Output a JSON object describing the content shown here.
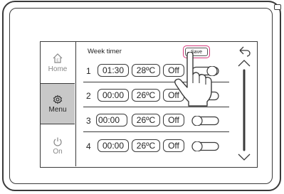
{
  "nav": {
    "items": [
      {
        "label": "Home",
        "icon": "home-icon",
        "active": false
      },
      {
        "label": "Menu",
        "icon": "gear-icon",
        "active": true
      },
      {
        "label": "On",
        "icon": "power-icon",
        "active": false
      }
    ]
  },
  "screen": {
    "title": "Week timer",
    "save_label": "Save"
  },
  "rows": [
    {
      "num": "1",
      "time": "01:30",
      "temp": "28ºC",
      "mode": "Off"
    },
    {
      "num": "2",
      "time": "00:00",
      "temp": "26ºC",
      "mode": "Off"
    },
    {
      "num": "3",
      "time": "00:00",
      "temp": "26ºC",
      "mode": "Off"
    },
    {
      "num": "4",
      "time": "00:00",
      "temp": "26ºC",
      "mode": "Off"
    }
  ],
  "colors": {
    "highlight": "#d4377a",
    "active_nav": "#c8c8c8",
    "outline": "#3a3a3a"
  }
}
